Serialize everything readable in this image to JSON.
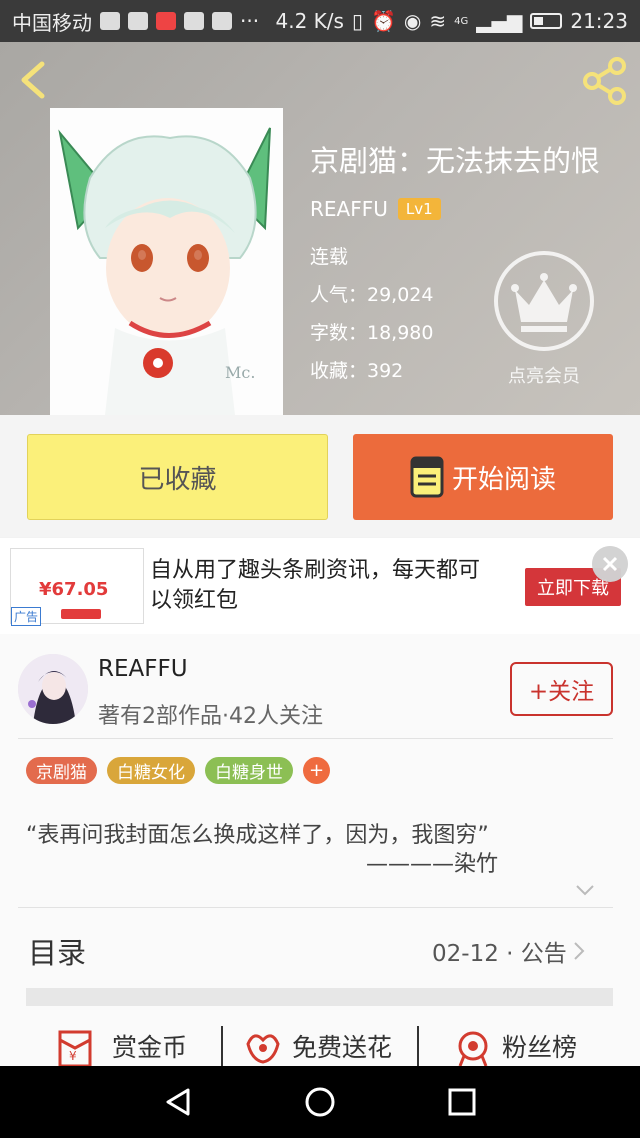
{
  "status_bar": {
    "carrier": "中国移动",
    "speed": "4.2 K/s",
    "network": "4G",
    "time": "21:23"
  },
  "book": {
    "title": "京剧猫：无法抹去的恨",
    "author": "REAFFU",
    "level": "Lv1",
    "status": "连载",
    "popularity": "人气：29,024",
    "word_count": "字数：18,980",
    "favorites": "收藏：392",
    "vip_label": "点亮会员"
  },
  "actions": {
    "favorited_label": "已收藏",
    "read_label": "开始阅读"
  },
  "ad": {
    "thumb_amount": "¥67.05",
    "tag": "广告",
    "text": "自从用了趣头条刷资讯，每天都可以领红包",
    "button": "立即下载"
  },
  "author_card": {
    "name": "REAFFU",
    "stats": "著有2部作品·42人关注",
    "follow_label": "+关注",
    "tags": [
      {
        "label": "京剧猫",
        "color": "#e36b4d"
      },
      {
        "label": "白糖女化",
        "color": "#d9a63a"
      },
      {
        "label": "白糖身世",
        "color": "#8cbf54"
      }
    ],
    "add_tag": "+",
    "quote": "“表再问我封面怎么换成这样了，因为，我图穷”",
    "quote_by": "————染竹"
  },
  "toc": {
    "label": "目录",
    "update": "02-12 · 公告"
  },
  "features": [
    {
      "label": "赏金币",
      "icon": "red-envelope-icon"
    },
    {
      "label": "免费送花",
      "icon": "flower-icon"
    },
    {
      "label": "粉丝榜",
      "icon": "medal-icon"
    }
  ],
  "colors": {
    "accent_orange": "#ec6b3c",
    "favorite_yellow": "#fbf07a",
    "follow_red": "#c9332d"
  }
}
